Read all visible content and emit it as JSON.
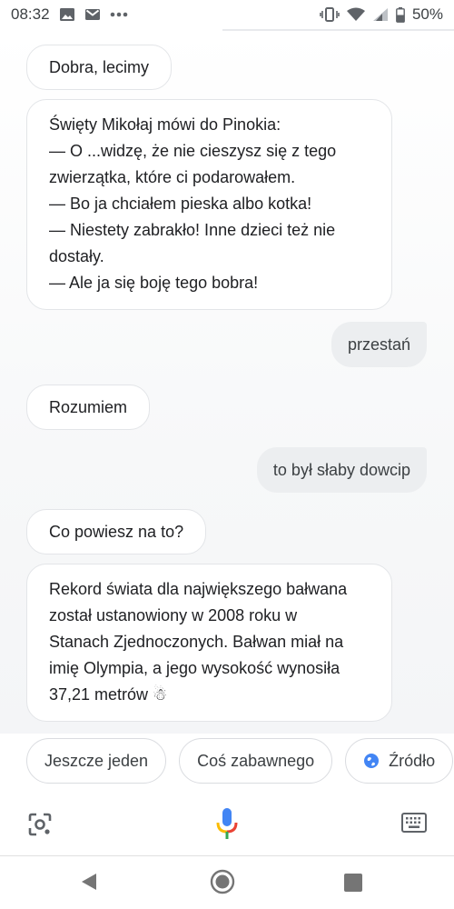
{
  "status_bar": {
    "time": "08:32",
    "battery": "50%",
    "icons": [
      "image-icon",
      "gmail-icon",
      "more-dots-icon",
      "vibrate-icon",
      "wifi-icon",
      "signal-icon",
      "battery-icon"
    ]
  },
  "conversation": {
    "msg1": "Dobra, lecimy",
    "msg2_lines": [
      "Święty Mikołaj mówi do Pinokia:",
      "— O ...widzę, że nie cieszysz się z tego",
      "zwierzątka, które ci podarowałem.",
      "— Bo ja chciałem pieska albo kotka!",
      "— Niestety zabrakło! Inne dzieci też nie",
      "dostały.",
      "— Ale ja się boję tego bobra!"
    ],
    "msg3_user": "przestań",
    "msg4": "Rozumiem",
    "msg5_user": "to był słaby dowcip",
    "msg6": "Co powiesz na to?",
    "msg7_lines": [
      "Rekord świata dla największego bałwana",
      "został ustanowiony w 2008 roku w",
      "Stanach Zjednoczonych. Bałwan miał na",
      "imię Olympia, a jego wysokość wynosiła",
      "37,21 metrów ☃"
    ]
  },
  "suggestions": {
    "chip1": "Jeszcze jeden",
    "chip2": "Coś zabawnego",
    "chip3": "Źródło"
  },
  "input_bar": {
    "icons": [
      "lens-icon",
      "mic-icon",
      "keyboard-icon"
    ]
  },
  "nav_bar": {
    "icons": [
      "back-icon",
      "home-icon",
      "recents-icon"
    ]
  },
  "colors": {
    "mic_blue": "#4285F4",
    "mic_red": "#EA4335",
    "mic_yellow": "#FBBC05",
    "mic_green": "#34A853",
    "globe_blue": "#4285F4"
  }
}
